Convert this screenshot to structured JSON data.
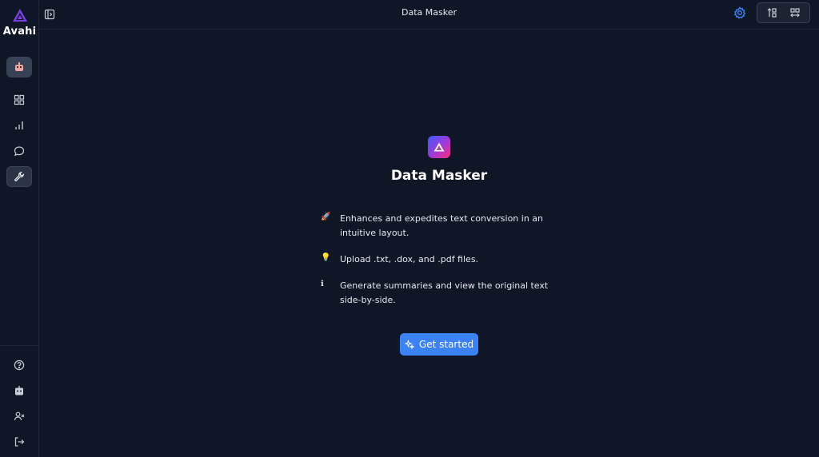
{
  "brand": {
    "name": "Avahi"
  },
  "header": {
    "title": "Data Masker"
  },
  "main": {
    "title": "Data Masker",
    "features": [
      {
        "icon": "rocket-icon",
        "text": "Enhances and expedites text conversion in an intuitive layout."
      },
      {
        "icon": "lightbulb-icon",
        "text": "Upload .txt, .dox, and .pdf files."
      },
      {
        "icon": "info-icon",
        "text": "Generate summaries and view the original text side-by-side."
      }
    ],
    "cta_label": "Get started"
  },
  "colors": {
    "background": "#0f1626",
    "accent": "#3b82f6",
    "gear": "#3b82f6"
  }
}
